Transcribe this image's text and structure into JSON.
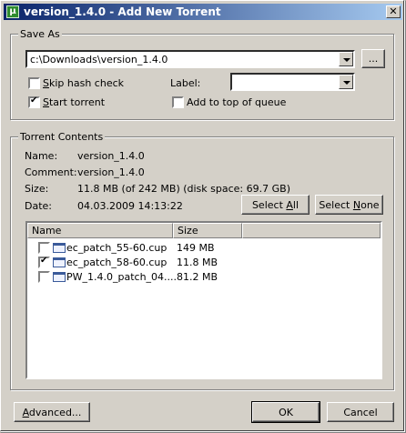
{
  "window": {
    "title": "version_1.4.0 - Add New Torrent",
    "close_glyph": "✕",
    "icon_letter": "μ"
  },
  "save_as": {
    "group_label": "Save As",
    "path_value": "c:\\Downloads\\version_1.4.0",
    "browse_label": "...",
    "skip_hash_check": {
      "label": "Skip hash check",
      "checked": false
    },
    "label_caption": "Label:",
    "label_value": "",
    "start_torrent": {
      "label": "Start torrent",
      "checked": true
    },
    "add_top_queue": {
      "label": "Add to top of queue",
      "checked": false
    }
  },
  "contents": {
    "group_label": "Torrent Contents",
    "name_caption": "Name:",
    "name_value": "version_1.4.0",
    "comment_caption": "Comment:",
    "comment_value": "version_1.4.0",
    "size_caption": "Size:",
    "size_value": "11.8 MB (of 242 MB) (disk space: 69.7 GB)",
    "date_caption": "Date:",
    "date_value": "04.03.2009 14:13:22",
    "select_all_label": "Select All",
    "select_none_label": "Select None",
    "columns": [
      "Name",
      "Size"
    ],
    "files": [
      {
        "name": "ec_patch_55-60.cup",
        "size": "149 MB",
        "checked": false,
        "icon": "cup-file-icon"
      },
      {
        "name": "ec_patch_58-60.cup",
        "size": "11.8 MB",
        "checked": true,
        "icon": "cup-file-icon"
      },
      {
        "name": "PW_1.4.0_patch_04....",
        "size": "81.2 MB",
        "checked": false,
        "icon": "window-file-icon"
      }
    ]
  },
  "footer": {
    "advanced_label": "Advanced...",
    "ok_label": "OK",
    "cancel_label": "Cancel"
  }
}
